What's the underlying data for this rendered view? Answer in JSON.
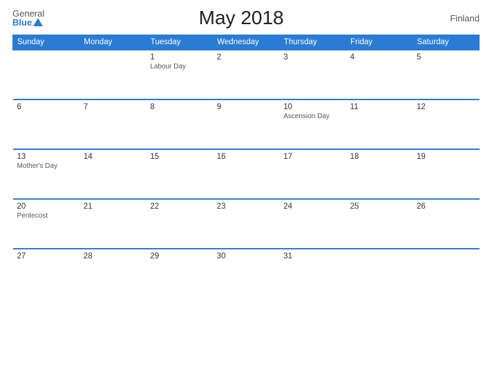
{
  "header": {
    "logo_general": "General",
    "logo_blue": "Blue",
    "title": "May 2018",
    "country": "Finland"
  },
  "weekdays": [
    "Sunday",
    "Monday",
    "Tuesday",
    "Wednesday",
    "Thursday",
    "Friday",
    "Saturday"
  ],
  "weeks": [
    [
      {
        "day": "",
        "holiday": ""
      },
      {
        "day": "",
        "holiday": ""
      },
      {
        "day": "1",
        "holiday": "Labour Day"
      },
      {
        "day": "2",
        "holiday": ""
      },
      {
        "day": "3",
        "holiday": ""
      },
      {
        "day": "4",
        "holiday": ""
      },
      {
        "day": "5",
        "holiday": ""
      }
    ],
    [
      {
        "day": "6",
        "holiday": ""
      },
      {
        "day": "7",
        "holiday": ""
      },
      {
        "day": "8",
        "holiday": ""
      },
      {
        "day": "9",
        "holiday": ""
      },
      {
        "day": "10",
        "holiday": "Ascension Day"
      },
      {
        "day": "11",
        "holiday": ""
      },
      {
        "day": "12",
        "holiday": ""
      }
    ],
    [
      {
        "day": "13",
        "holiday": "Mother's Day"
      },
      {
        "day": "14",
        "holiday": ""
      },
      {
        "day": "15",
        "holiday": ""
      },
      {
        "day": "16",
        "holiday": ""
      },
      {
        "day": "17",
        "holiday": ""
      },
      {
        "day": "18",
        "holiday": ""
      },
      {
        "day": "19",
        "holiday": ""
      }
    ],
    [
      {
        "day": "20",
        "holiday": "Pentecost"
      },
      {
        "day": "21",
        "holiday": ""
      },
      {
        "day": "22",
        "holiday": ""
      },
      {
        "day": "23",
        "holiday": ""
      },
      {
        "day": "24",
        "holiday": ""
      },
      {
        "day": "25",
        "holiday": ""
      },
      {
        "day": "26",
        "holiday": ""
      }
    ],
    [
      {
        "day": "27",
        "holiday": ""
      },
      {
        "day": "28",
        "holiday": ""
      },
      {
        "day": "29",
        "holiday": ""
      },
      {
        "day": "30",
        "holiday": ""
      },
      {
        "day": "31",
        "holiday": ""
      },
      {
        "day": "",
        "holiday": ""
      },
      {
        "day": "",
        "holiday": ""
      }
    ]
  ]
}
